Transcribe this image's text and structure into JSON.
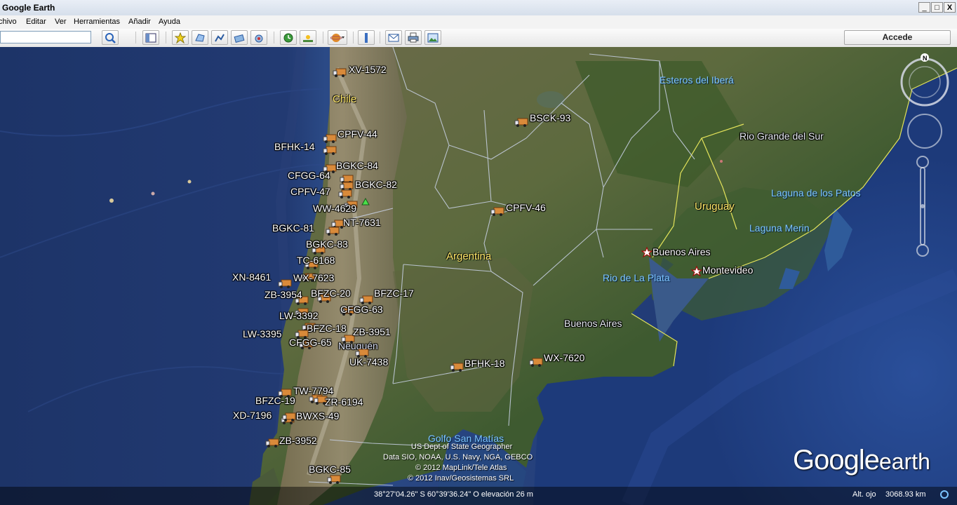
{
  "window": {
    "title": "Google Earth",
    "min": "_",
    "max": "□",
    "close": "X"
  },
  "menu": [
    "chivo",
    "Editar",
    "Ver",
    "Herramientas",
    "Añadir",
    "Ayuda"
  ],
  "toolbar": {
    "search_value": "",
    "login_label": "Accede"
  },
  "map": {
    "countries": [
      {
        "name": "Chile",
        "key": "chile"
      },
      {
        "name": "Argentina",
        "key": "argentina"
      },
      {
        "name": "Uruguay",
        "key": "uruguay"
      }
    ],
    "regions": {
      "ibera": "Esteros del Iberá",
      "rio_grande": "Rio Grande del Sur",
      "buenos_aires_prov": "Buenos Aires",
      "neuquen": "Neuquén"
    },
    "water": {
      "patos": "Laguna de los Patos",
      "merin": "Laguna Merin",
      "plata": "Rio de La Plata",
      "golfo": "Golfo San Matías"
    },
    "cities": {
      "buenos_aires": "Buenos Aires",
      "montevideo": "Montevideo"
    },
    "markers": [
      "XV-1572",
      "CPFV-44",
      "BFHK-14",
      "BGKC-84",
      "CFGG-64",
      "BGKC-82",
      "CPFV-47",
      "WW-4629",
      "NT-7631",
      "BGKC-81",
      "BGKC-83",
      "TC-6168",
      "XN-8461",
      "WX-7623",
      "ZB-3954",
      "BFZC-20",
      "BFZC-17",
      "CFGG-63",
      "LW-3392",
      "BFZC-18",
      "ZB-3951",
      "LW-3395",
      "CFGG-65",
      "UK-7438",
      "BFHK-18",
      "WX-7620",
      "TW-7794",
      "BFZC-19",
      "ZR-6194",
      "XD-7196",
      "BWXS-49",
      "ZB-3952",
      "BGKC-85",
      "BSCK-93",
      "CPFV-46"
    ],
    "attribution": [
      "US Dept of State Geographer",
      "Data SIO, NOAA, U.S. Navy, NGA, GEBCO",
      "© 2012 MapLink/Tele Atlas",
      "© 2012 Inav/Geosistemas SRL"
    ],
    "logo_google": "Google",
    "logo_earth": "earth",
    "compass_north": "N"
  },
  "status": {
    "coords": "38°27'04.26\" S   60°39'36.24\" O  elevación    26 m",
    "eye_alt_label": "Alt. ojo",
    "eye_alt_value": "3068.93 km"
  },
  "colors": {
    "ocean": "#16295a",
    "land": "#4e5a36",
    "border": "#cfd6e6",
    "coast": "#e8e85a"
  }
}
